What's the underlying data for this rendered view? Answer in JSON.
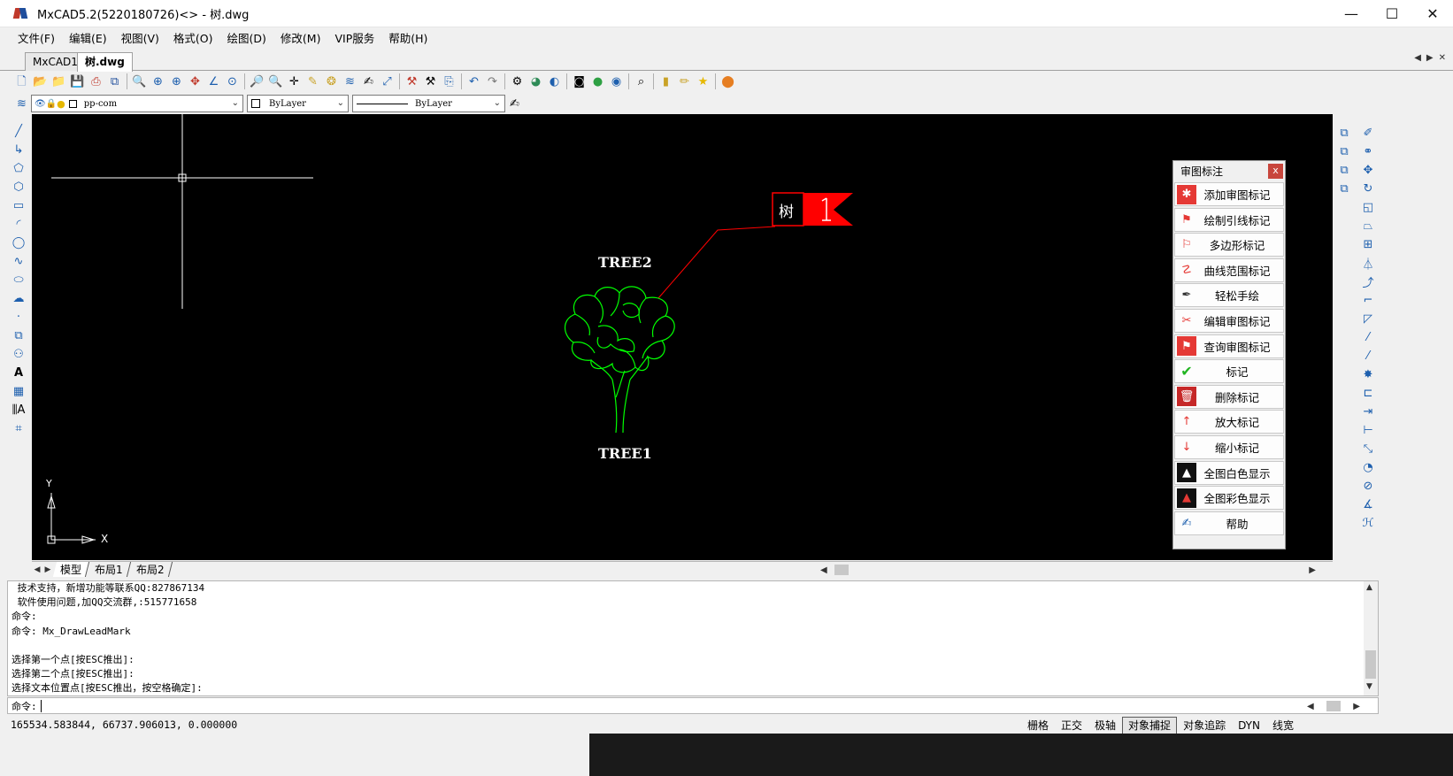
{
  "window": {
    "title": "MxCAD5.2(5220180726)<> - 树.dwg",
    "minimize": "—",
    "maximize": "☐",
    "close": "✕"
  },
  "menu": [
    "文件(F)",
    "编辑(E)",
    "视图(V)",
    "格式(O)",
    "绘图(D)",
    "修改(M)",
    "VIP服务",
    "帮助(H)"
  ],
  "doc_tabs": [
    "MxCAD1",
    "树.dwg"
  ],
  "layer_bar": {
    "layer": "pp-com",
    "color": "ByLayer",
    "linetype": "ByLayer"
  },
  "canvas": {
    "labels": {
      "tree2": "TREE2",
      "tree1": "TREE1",
      "mark_text": "树",
      "mark_number": "1",
      "ucs_x": "X",
      "ucs_y": "Y"
    },
    "colors": {
      "background": "#000000",
      "tree": "#00ff00",
      "leader": "#ff0000",
      "text": "#ffffff"
    }
  },
  "review_panel": {
    "title": "审图标注",
    "close": "x",
    "buttons": [
      {
        "label": "添加审图标记",
        "icon": "add-mark-icon"
      },
      {
        "label": "绘制引线标记",
        "icon": "leader-mark-icon"
      },
      {
        "label": "多边形标记",
        "icon": "polygon-mark-icon"
      },
      {
        "label": "曲线范围标记",
        "icon": "curve-mark-icon"
      },
      {
        "label": "轻松手绘",
        "icon": "pen-icon"
      },
      {
        "label": "编辑审图标记",
        "icon": "edit-mark-icon"
      },
      {
        "label": "查询审图标记",
        "icon": "query-mark-icon"
      },
      {
        "label": "标记",
        "icon": "check-mark-icon"
      },
      {
        "label": "删除标记",
        "icon": "delete-mark-icon"
      },
      {
        "label": "放大标记",
        "icon": "enlarge-mark-icon"
      },
      {
        "label": "缩小标记",
        "icon": "shrink-mark-icon"
      },
      {
        "label": "全图白色显示",
        "icon": "white-display-icon"
      },
      {
        "label": "全图彩色显示",
        "icon": "color-display-icon"
      },
      {
        "label": "帮助",
        "icon": "help-icon"
      }
    ]
  },
  "layout_tabs": [
    "模型",
    "布局1",
    "布局2"
  ],
  "command_history": [
    " 技术支持，新增功能等联系QQ:827867134",
    " 软件使用问题,加QQ交流群,:515771658",
    "命令:",
    "命令: Mx_DrawLeadMark",
    "",
    "选择第一个点[按ESC推出]:",
    "选择第二个点[按ESC推出]:",
    "选择文本位置点[按ESC推出，按空格确定]:"
  ],
  "command_prompt": "命令:",
  "status": {
    "coords": "165534.583844,  66737.906013,  0.000000",
    "toggles": [
      {
        "label": "栅格",
        "on": false
      },
      {
        "label": "正交",
        "on": false
      },
      {
        "label": "极轴",
        "on": false
      },
      {
        "label": "对象捕捉",
        "on": true
      },
      {
        "label": "对象追踪",
        "on": false
      },
      {
        "label": "DYN",
        "on": false
      },
      {
        "label": "线宽",
        "on": false
      }
    ]
  }
}
